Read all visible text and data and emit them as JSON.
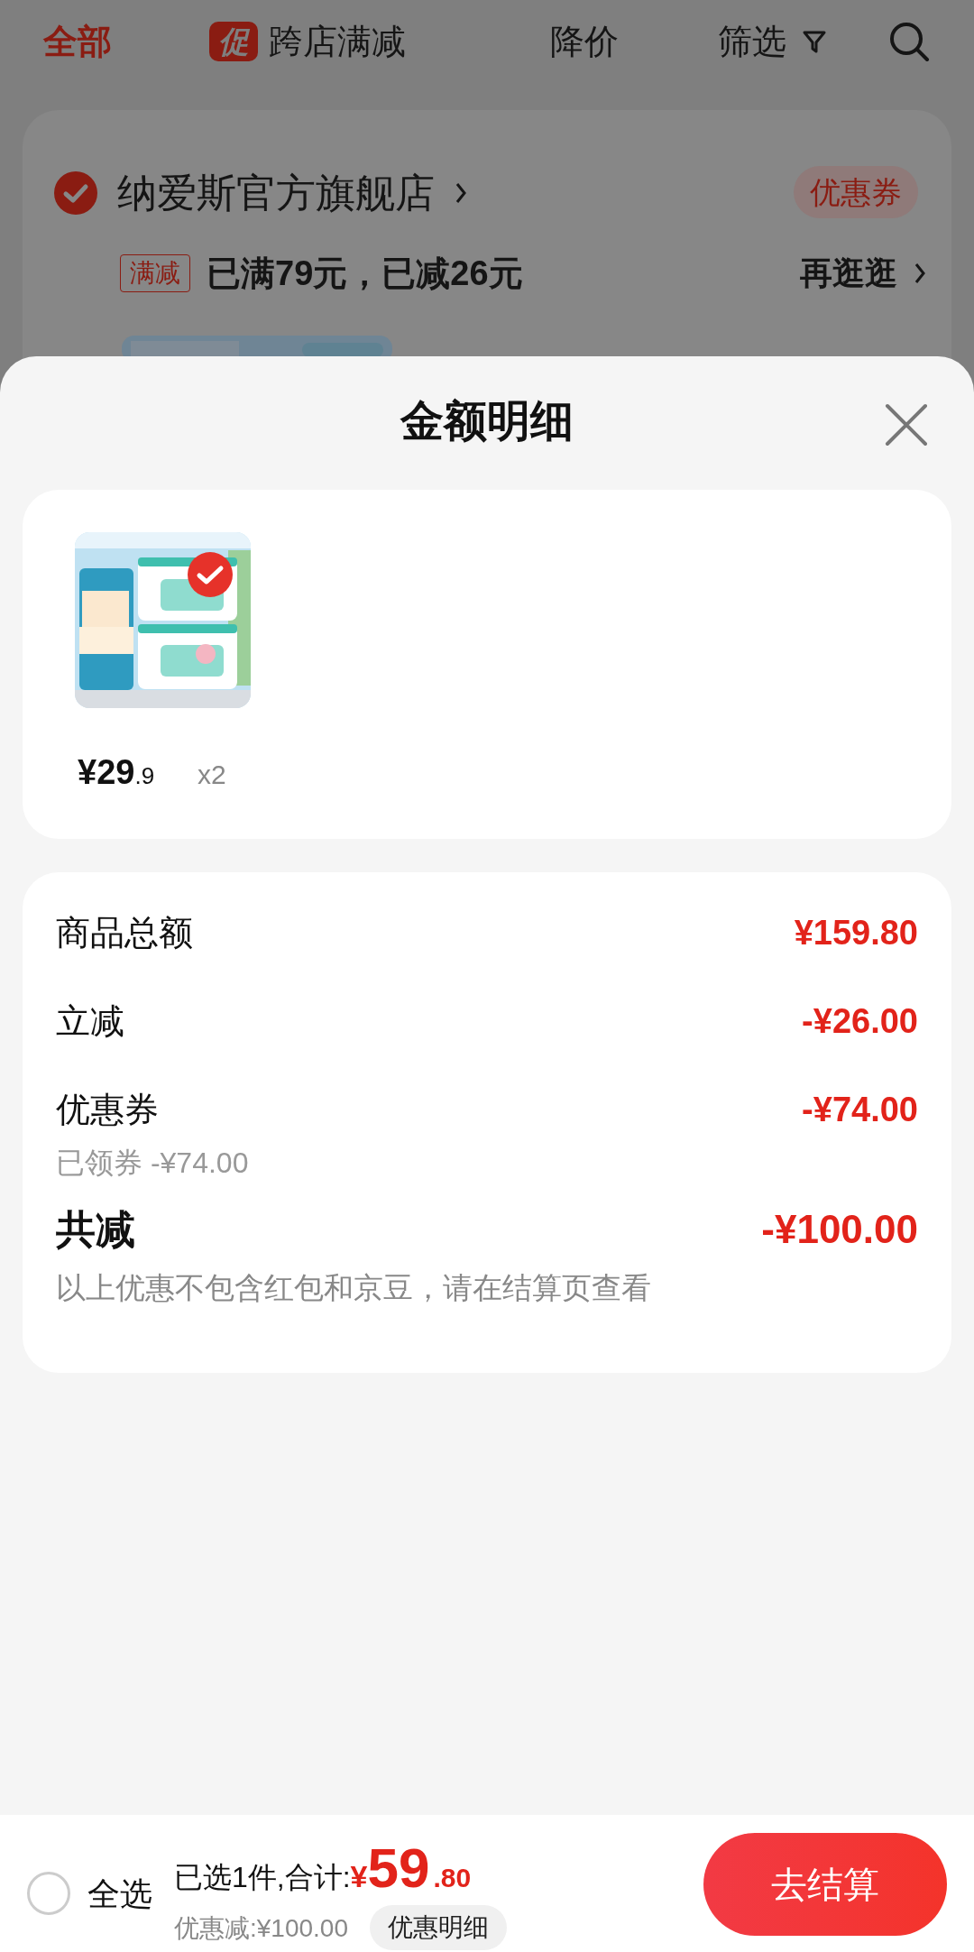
{
  "top_tabs": [
    {
      "label": "全部",
      "selected": true,
      "kind": "plain"
    },
    {
      "label": "跨店满减",
      "badge": "促",
      "selected": false,
      "kind": "badge"
    },
    {
      "label": "降价",
      "selected": false,
      "kind": "plain"
    },
    {
      "label": "筛选",
      "selected": false,
      "kind": "filter"
    }
  ],
  "store": {
    "name": "纳爱斯官方旗舰店",
    "checked": true,
    "coupon_button": "优惠券",
    "promo_tag": "满减",
    "promo_text": "已满79元，已减26元",
    "link": "再逛逛"
  },
  "sheet": {
    "title": "金额明细",
    "items": [
      {
        "kind": "picture",
        "checked": true,
        "price_main": "¥29",
        "price_fraction": ".9",
        "quantity": "x2"
      }
    ],
    "summary": [
      {
        "label": "商品总额",
        "value": "¥159.80"
      },
      {
        "label": "立减",
        "value": "-¥26.00"
      },
      {
        "label": "优惠券",
        "value": "-¥74.00",
        "sub": "已领券 -¥74.00"
      }
    ],
    "total": {
      "label": "共减",
      "value": "-¥100.00"
    },
    "note": "以上优惠不包含红包和京豆，请在结算页查看"
  },
  "bottom_bar": {
    "select_all": {
      "label": "全选",
      "checked": false
    },
    "selected_count": "已选1件,合计:",
    "currency": "¥",
    "amount_main": "59",
    "amount_fraction": ".80",
    "discount": "优惠减:¥100.00",
    "details_button": "优惠明细",
    "checkout_button": "去结算"
  }
}
